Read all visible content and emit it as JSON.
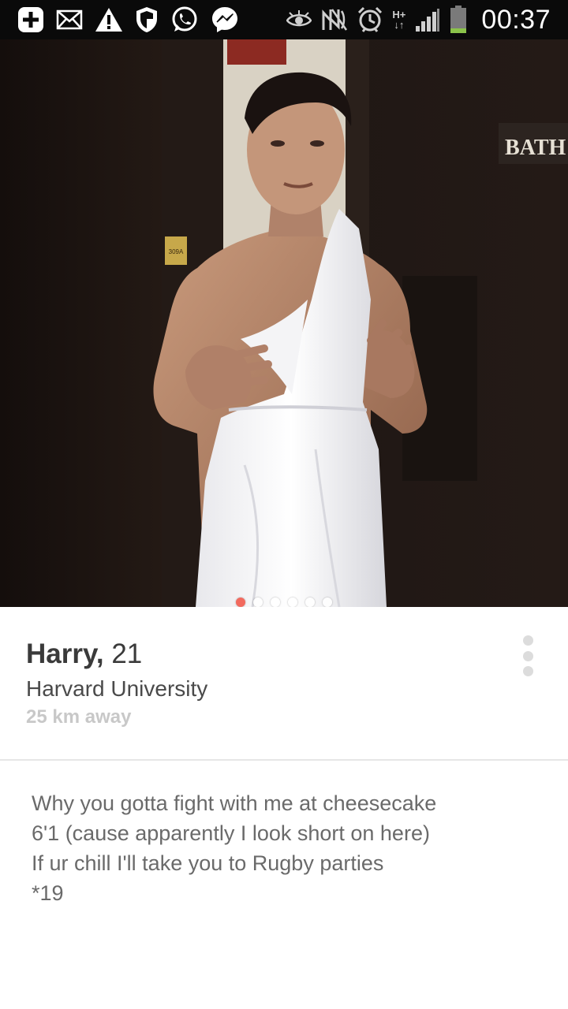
{
  "status_bar": {
    "time": "00:37",
    "network_type_top": "H+",
    "network_type_bottom": "↓↑",
    "left_icons": [
      "plus-icon",
      "mail-icon",
      "warning-icon",
      "shield-icon",
      "whatsapp-icon",
      "messenger-icon"
    ],
    "right_icons": [
      "eye-icon",
      "nfc-icon",
      "alarm-icon",
      "signal-icon",
      "battery-icon"
    ],
    "battery_level": 0.2,
    "battery_color": "#8bc34a"
  },
  "photo": {
    "door_sign": "BATH",
    "room_plate": "309A",
    "photo_count": 6,
    "active_photo_index": 0,
    "active_dot_color": "#f26a5e"
  },
  "profile": {
    "name": "Harry,",
    "age": "21",
    "school": "Harvard University",
    "distance": "25 km away"
  },
  "bio": {
    "lines": [
      "Why you gotta fight with me at cheesecake",
      "6'1 (cause apparently I look short on here)",
      "If ur chill I'll take you to Rugby parties",
      "*19"
    ]
  }
}
